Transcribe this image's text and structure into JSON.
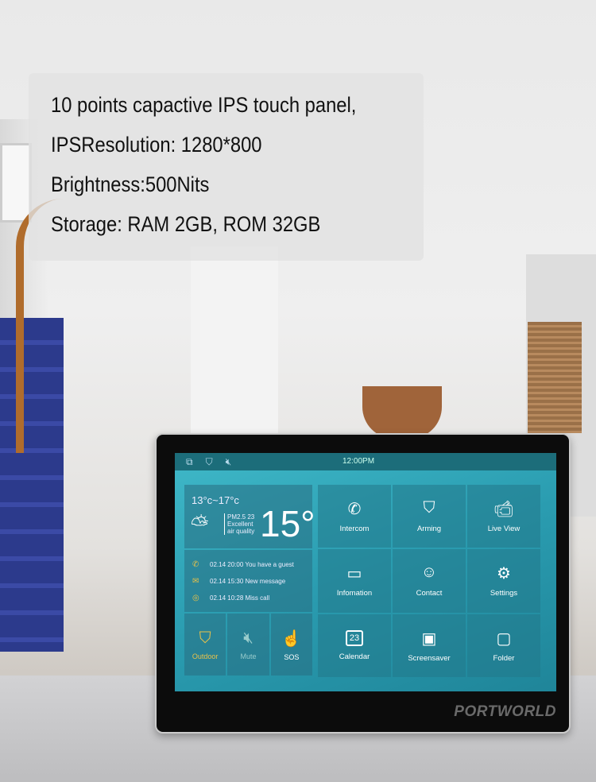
{
  "overlay": {
    "lines": [
      "10 points capactive IPS touch panel,",
      "IPSResolution: 1280*800",
      "Brightness:500Nits",
      "Storage: RAM 2GB, ROM 32GB"
    ]
  },
  "device": {
    "brand": "PORTWORLD"
  },
  "screen": {
    "status": {
      "icons": [
        "window-icon",
        "shield-icon",
        "mute-icon"
      ],
      "time": "12:00PM"
    },
    "weather": {
      "range": "13°c~17°c",
      "pm": "PM2.5  23",
      "quality1": "Excellent",
      "quality2": "air quality",
      "temp": "15°",
      "icon": "partly-cloudy-icon"
    },
    "messages": [
      {
        "icon": "phone-icon",
        "text": "02.14  20:00  You have a guest"
      },
      {
        "icon": "mail-icon",
        "text": "02.14  15:30  New message"
      },
      {
        "icon": "chat-icon",
        "text": "02.14  10:28  Miss call"
      }
    ],
    "quick": [
      {
        "label": "Outdoor",
        "icon": "shield-check-icon",
        "color": "#e8c24a"
      },
      {
        "label": "Mute",
        "icon": "mute-icon"
      },
      {
        "label": "SOS",
        "icon": "hand-icon"
      }
    ],
    "tiles": [
      {
        "label": "Intercom",
        "icon": "phone-icon"
      },
      {
        "label": "Arming",
        "icon": "home-shield-icon"
      },
      {
        "label": "Live View",
        "icon": "camera-icon"
      },
      {
        "label": "Infomation",
        "icon": "message-icon"
      },
      {
        "label": "Contact",
        "icon": "contact-icon"
      },
      {
        "label": "Settings",
        "icon": "gear-icon"
      },
      {
        "label": "Calendar",
        "icon": "calendar-icon"
      },
      {
        "label": "Screensaver",
        "icon": "picture-icon"
      },
      {
        "label": "Folder",
        "icon": "folder-icon"
      }
    ]
  }
}
